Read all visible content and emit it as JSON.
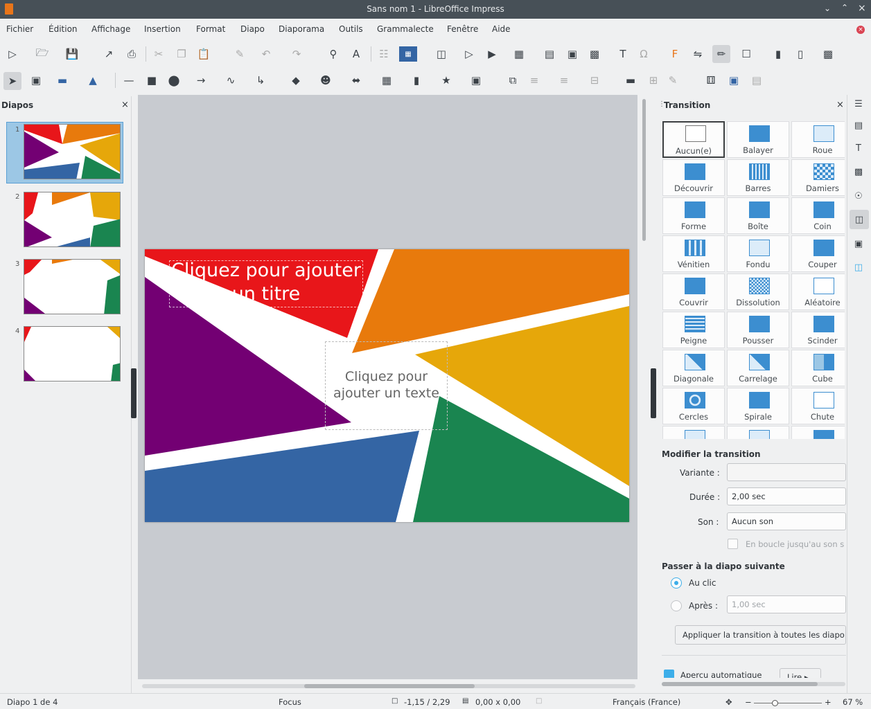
{
  "window": {
    "title": "Sans nom 1 - LibreOffice Impress"
  },
  "menu": [
    "Fichier",
    "Édition",
    "Affichage",
    "Insertion",
    "Format",
    "Diapo",
    "Diaporama",
    "Outils",
    "Grammalecte",
    "Fenêtre",
    "Aide"
  ],
  "slides_panel": {
    "title": "Diapos",
    "close": "×",
    "slide_numbers": [
      "1",
      "2",
      "3",
      "4"
    ]
  },
  "slide": {
    "title_placeholder": "Cliquez pour ajouter un titre",
    "text_placeholder": "Cliquez pour ajouter un texte"
  },
  "transition_panel": {
    "title": "Transition",
    "close": "×",
    "transitions": [
      "Aucun(e)",
      "Balayer",
      "Roue",
      "Découvrir",
      "Barres",
      "Damiers",
      "Forme",
      "Boîte",
      "Coin",
      "Vénitien",
      "Fondu",
      "Couper",
      "Couvrir",
      "Dissolution",
      "Aléatoire",
      "Peigne",
      "Pousser",
      "Scinder",
      "Diagonale",
      "Carrelage",
      "Cube",
      "Cercles",
      "Spirale",
      "Chute"
    ],
    "modify_header": "Modifier la transition",
    "variant_label": "Variante :",
    "variant_value": "",
    "duration_label": "Durée :",
    "duration_value": "2,00 sec",
    "sound_label": "Son :",
    "sound_value": "Aucun son",
    "loop_label": "En boucle jusqu'au son s",
    "advance_header": "Passer à la diapo suivante",
    "on_click_label": "Au clic",
    "after_label": "Après :",
    "after_value": "1,00 sec",
    "apply_all_button": "Appliquer la transition à toutes les diapo",
    "auto_preview_label": "Aperçu automatique",
    "play_button": "Lire"
  },
  "status": {
    "slide_info": "Diapo 1 de 4",
    "mode": "Focus",
    "position": "-1,15 / 2,29",
    "size": "0,00 x 0,00",
    "language": "Français (France)",
    "zoom": "67 %"
  },
  "colors": {
    "red": "#e8161a",
    "orange": "#e87a0c",
    "amber": "#e6a70a",
    "purple": "#730073",
    "blue": "#3465a4",
    "green": "#1a8550"
  }
}
